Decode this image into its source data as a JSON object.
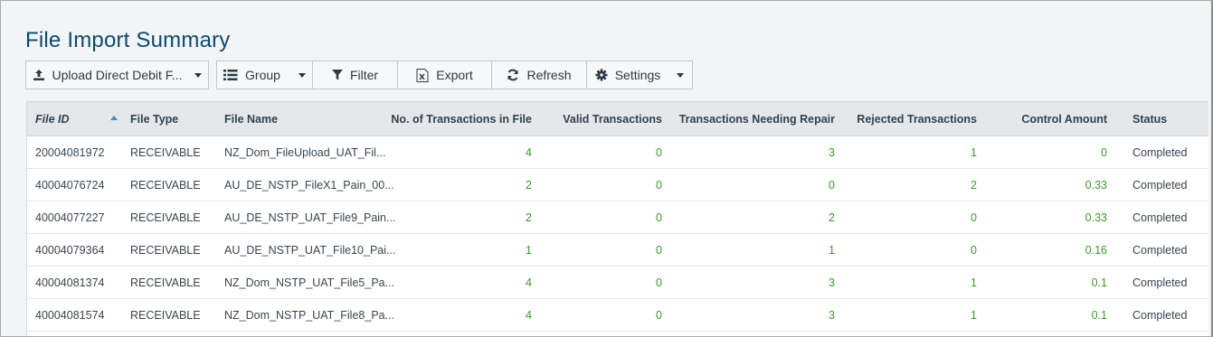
{
  "page": {
    "title": "File Import Summary"
  },
  "toolbar": {
    "upload_label": "Upload Direct Debit F...",
    "group_label": "Group",
    "filter_label": "Filter",
    "export_label": "Export",
    "refresh_label": "Refresh",
    "settings_label": "Settings"
  },
  "table": {
    "columns": [
      "File ID",
      "File Type",
      "File Name",
      "No. of Transactions in File",
      "Valid Transactions",
      "Transactions Needing Repair",
      "Rejected Transactions",
      "Control Amount",
      "Status"
    ],
    "sort": {
      "column": "File ID",
      "direction": "ascending"
    },
    "rows": [
      [
        "20004081972",
        "RECEIVABLE",
        "NZ_Dom_FileUpload_UAT_Fil...",
        "4",
        "0",
        "3",
        "1",
        "0",
        "Completed"
      ],
      [
        "40004076724",
        "RECEIVABLE",
        "AU_DE_NSTP_FileX1_Pain_00...",
        "2",
        "0",
        "0",
        "2",
        "0.33",
        "Completed"
      ],
      [
        "40004077227",
        "RECEIVABLE",
        "AU_DE_NSTP_UAT_File9_Pain...",
        "2",
        "0",
        "2",
        "0",
        "0.33",
        "Completed"
      ],
      [
        "40004079364",
        "RECEIVABLE",
        "AU_DE_NSTP_UAT_File10_Pai...",
        "1",
        "0",
        "1",
        "0",
        "0.16",
        "Completed"
      ],
      [
        "40004081374",
        "RECEIVABLE",
        "NZ_Dom_NSTP_UAT_File5_Pa...",
        "4",
        "0",
        "3",
        "1",
        "0.1",
        "Completed"
      ],
      [
        "40004081574",
        "RECEIVABLE",
        "NZ_Dom_NSTP_UAT_File8_Pa...",
        "4",
        "0",
        "3",
        "1",
        "0.1",
        "Completed"
      ]
    ]
  },
  "colors": {
    "title": "#0b4a6f",
    "header_bg": "#e4e8eb",
    "numeric_text": "#3a9a2a",
    "sort_indicator": "#4b88b5"
  }
}
